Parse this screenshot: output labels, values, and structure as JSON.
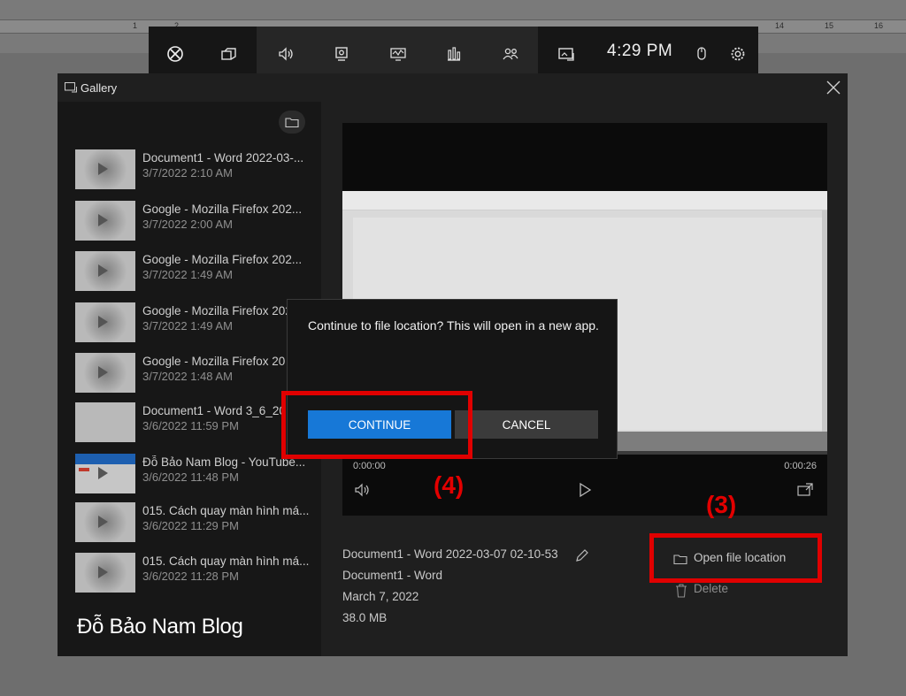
{
  "ruler": {
    "numbers": [
      "1",
      "2",
      "14",
      "15",
      "16"
    ]
  },
  "gamebar": {
    "time": "4:29 PM",
    "icons": [
      "xbox-icon",
      "widget-menu-icon",
      "audio-icon",
      "capture-icon",
      "performance-icon",
      "resources-icon",
      "social-icon",
      "gallery-icon",
      "mouse-icon",
      "settings-icon"
    ]
  },
  "gallery": {
    "title": "Gallery",
    "items": [
      {
        "title": "Document1 - Word 2022-03-...",
        "date": "3/7/2022 2:10 AM"
      },
      {
        "title": "Google - Mozilla Firefox 202...",
        "date": "3/7/2022 2:00 AM"
      },
      {
        "title": "Google - Mozilla Firefox 202...",
        "date": "3/7/2022 1:49 AM"
      },
      {
        "title": "Google - Mozilla Firefox 202...",
        "date": "3/7/2022 1:49 AM"
      },
      {
        "title": "Google - Mozilla Firefox 20",
        "date": "3/7/2022 1:48 AM"
      },
      {
        "title": "Document1 - Word 3_6_20",
        "date": "3/6/2022 11:59 PM"
      },
      {
        "title": "Đỗ Bảo Nam Blog - YouTube...",
        "date": "3/6/2022 11:48 PM"
      },
      {
        "title": "015. Cách quay màn hình má...",
        "date": "3/6/2022 11:29 PM"
      },
      {
        "title": "015. Cách quay màn hình má...",
        "date": "3/6/2022 11:28 PM"
      }
    ],
    "watermark": "Đỗ Bảo Nam Blog"
  },
  "player": {
    "time_start": "0:00:00",
    "time_end": "0:00:26",
    "progress": 0
  },
  "details": {
    "file_name": "Document1 - Word 2022-03-07 02-10-53",
    "app": "Document1 - Word",
    "date": "March 7, 2022",
    "size": "38.0 MB"
  },
  "actions": {
    "open_location": "Open file location",
    "delete": "Delete"
  },
  "dialog": {
    "message": "Continue to file location? This will open in a new app.",
    "continue": "CONTINUE",
    "cancel": "CANCEL"
  },
  "annotations": {
    "step3": "(3)",
    "step4": "(4)"
  },
  "colors": {
    "accent": "#1778d7",
    "annotation": "#e00000"
  }
}
